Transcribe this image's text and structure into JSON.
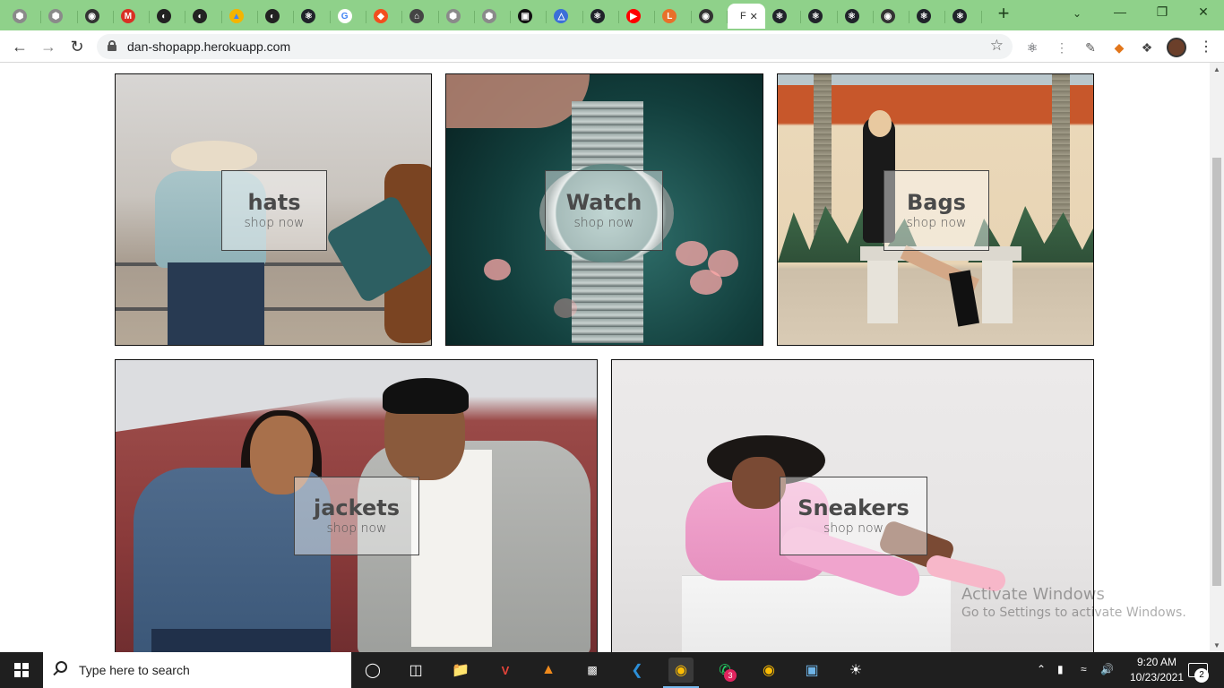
{
  "browser": {
    "active_tab": {
      "title": "F",
      "close": "✕"
    },
    "new_tab": "+",
    "url": "dan-shopapp.herokuapp.com",
    "colors": {
      "frame": "#8fd18a",
      "toolbar": "#ffffff"
    }
  },
  "tabs": [
    {
      "icon": "extension-icon",
      "color": "#8a8a8a",
      "glyph": "⬢"
    },
    {
      "icon": "extension-icon",
      "color": "#8a8a8a",
      "glyph": "⬢"
    },
    {
      "icon": "globe-icon",
      "color": "#333333",
      "glyph": "◉"
    },
    {
      "icon": "gmail-icon",
      "color": "#d93025",
      "glyph": "M"
    },
    {
      "icon": "github-icon",
      "color": "#222222",
      "glyph": "◐"
    },
    {
      "icon": "github-icon",
      "color": "#222222",
      "glyph": "◐"
    },
    {
      "icon": "drive-icon",
      "color": "#f4b400",
      "glyph": "▲"
    },
    {
      "icon": "github-icon",
      "color": "#222222",
      "glyph": "◐"
    },
    {
      "icon": "react-icon",
      "color": "#20232a",
      "glyph": "⚛"
    },
    {
      "icon": "google-icon",
      "color": "#ffffff",
      "glyph": "G"
    },
    {
      "icon": "figma-icon",
      "color": "#f24e1e",
      "glyph": "◆"
    },
    {
      "icon": "house-icon",
      "color": "#444444",
      "glyph": "⌂"
    },
    {
      "icon": "extension-icon",
      "color": "#8a8a8a",
      "glyph": "⬢"
    },
    {
      "icon": "extension-icon",
      "color": "#8a8a8a",
      "glyph": "⬢"
    },
    {
      "icon": "unsplash-icon",
      "color": "#111111",
      "glyph": "▣"
    },
    {
      "icon": "triangle-icon",
      "color": "#3b6fd8",
      "glyph": "△"
    },
    {
      "icon": "react-icon",
      "color": "#20232a",
      "glyph": "⚛"
    },
    {
      "icon": "youtube-icon",
      "color": "#ff0000",
      "glyph": "▶"
    },
    {
      "icon": "ls-icon",
      "color": "#e8702a",
      "glyph": "L"
    },
    {
      "icon": "globe-icon",
      "color": "#333333",
      "glyph": "◉"
    },
    {
      "icon": "react-icon",
      "color": "#20232a",
      "glyph": "⚛"
    },
    {
      "icon": "react-icon",
      "color": "#20232a",
      "glyph": "⚛"
    },
    {
      "icon": "react-icon",
      "color": "#20232a",
      "glyph": "⚛"
    },
    {
      "icon": "globe-icon",
      "color": "#333333",
      "glyph": "◉"
    },
    {
      "icon": "react-icon",
      "color": "#20232a",
      "glyph": "⚛"
    },
    {
      "icon": "react-icon",
      "color": "#20232a",
      "glyph": "⚛"
    }
  ],
  "categories": [
    {
      "title": "hats",
      "sub": "shop now"
    },
    {
      "title": "Watch",
      "sub": "shop now"
    },
    {
      "title": "Bags",
      "sub": "shop now"
    },
    {
      "title": "jackets",
      "sub": "shop now"
    },
    {
      "title": "Sneakers",
      "sub": "shop now"
    }
  ],
  "watermark": {
    "line1": "Activate Windows",
    "line2": "Go to Settings to activate Windows."
  },
  "taskbar": {
    "search_placeholder": "Type here to search",
    "time": "9:20 AM",
    "date": "10/23/2021",
    "notification_count": "2",
    "whatsapp_badge": "3"
  }
}
